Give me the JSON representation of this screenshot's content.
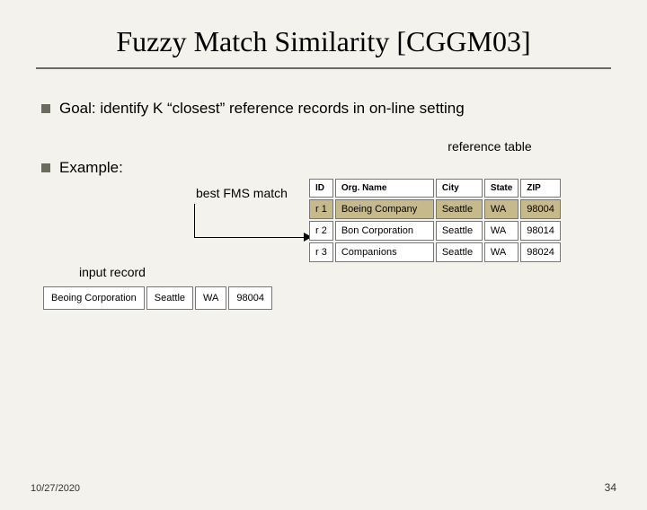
{
  "title": "Fuzzy Match Similarity [CGGM03]",
  "bullets": {
    "goal": "Goal: identify K “closest” reference records in on-line setting",
    "example": "Example:"
  },
  "labels": {
    "reference_table": "reference table",
    "best_fms_match": "best FMS match",
    "input_record": "input record"
  },
  "reference_table": {
    "headers": {
      "id": "ID",
      "org": "Org. Name",
      "city": "City",
      "state": "State",
      "zip": "ZIP"
    },
    "rows": [
      {
        "id": "r 1",
        "org": "Boeing Company",
        "city": "Seattle",
        "state": "WA",
        "zip": "98004",
        "hl": true
      },
      {
        "id": "r 2",
        "org": "Bon Corporation",
        "city": "Seattle",
        "state": "WA",
        "zip": "98014",
        "hl": false
      },
      {
        "id": "r 3",
        "org": "Companions",
        "city": "Seattle",
        "state": "WA",
        "zip": "98024",
        "hl": false
      }
    ]
  },
  "input_record": {
    "org": "Beoing Corporation",
    "city": "Seattle",
    "state": "WA",
    "zip": "98004"
  },
  "footer": {
    "date": "10/27/2020",
    "page": "34"
  }
}
